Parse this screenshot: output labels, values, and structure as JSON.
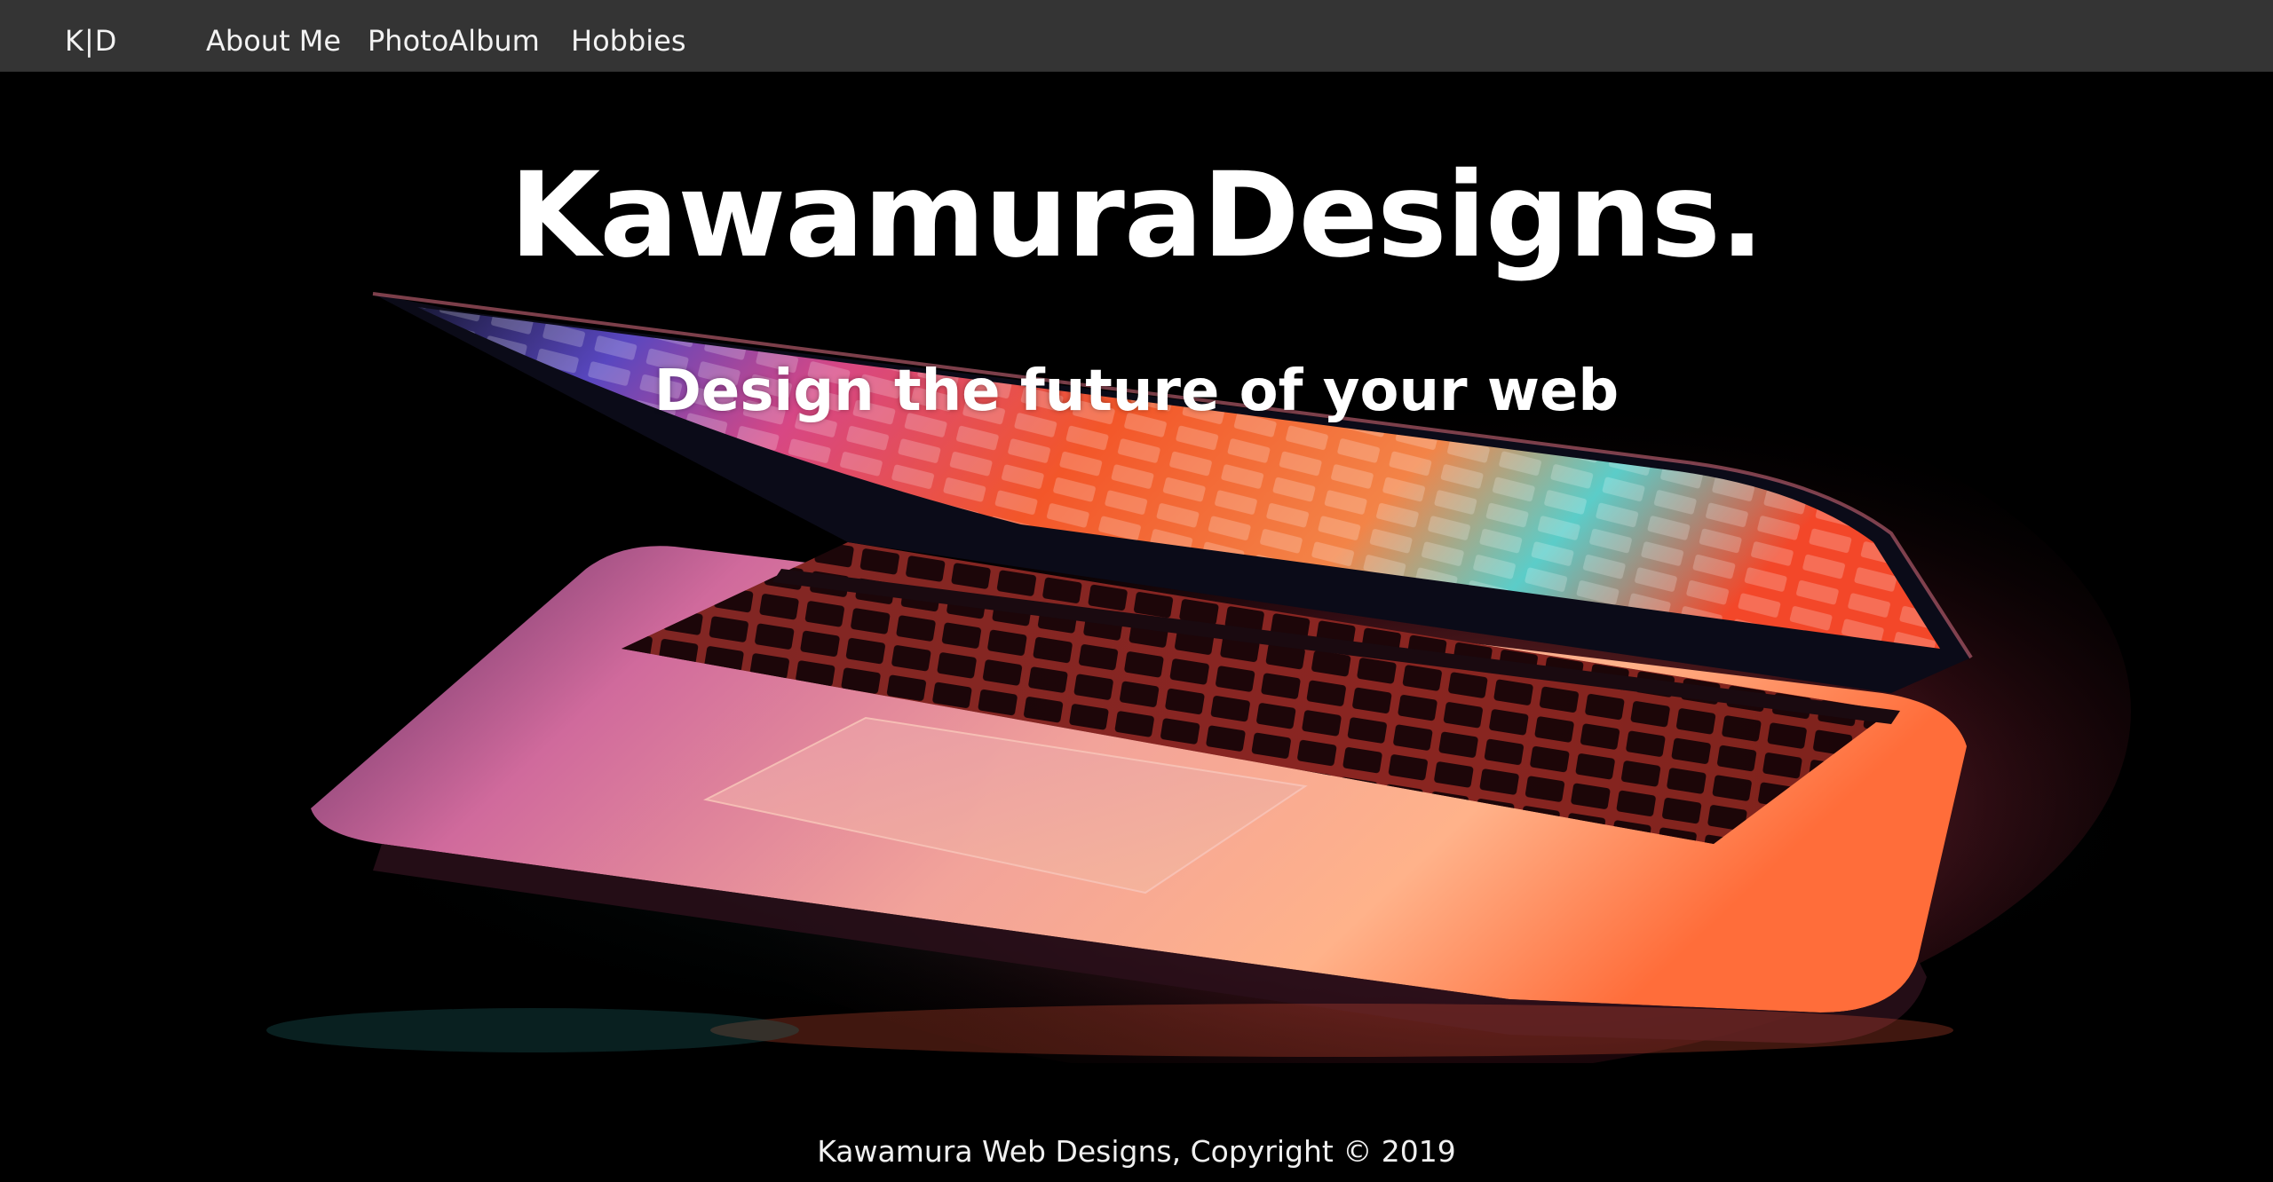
{
  "navbar": {
    "brand": "K|D",
    "links": [
      {
        "label": "About Me"
      },
      {
        "label": "PhotoAlbum"
      },
      {
        "label": "Hobbies"
      }
    ]
  },
  "hero": {
    "title": "KawamuraDesigns.",
    "subtitle": "Design the future of your web",
    "background_image": "laptop-photo"
  },
  "footer": {
    "text": "Kawamura Web Designs, Copyright © 2019"
  },
  "colors": {
    "navbar_bg": "#343434",
    "page_bg": "#000000",
    "text": "#ffffff"
  }
}
